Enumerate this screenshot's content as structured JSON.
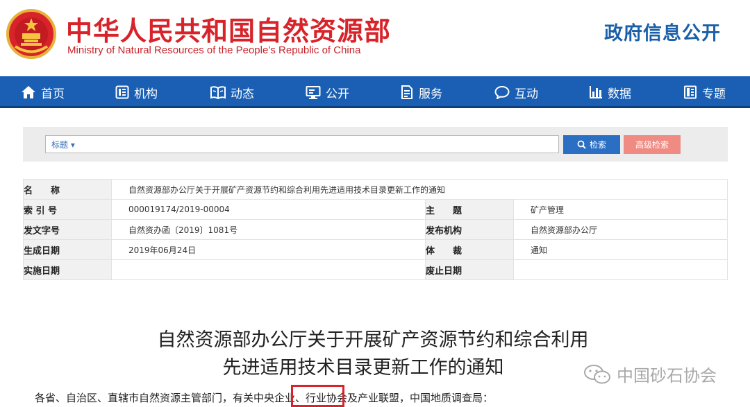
{
  "header": {
    "title_cn": "中华人民共和国自然资源部",
    "title_en": "Ministry of Natural Resources of the People’s Republic of China",
    "gov_open": "政府信息公开",
    "brand_color": "#d8232a"
  },
  "nav": {
    "items": [
      {
        "label": "首页",
        "icon": "home-icon"
      },
      {
        "label": "机构",
        "icon": "org-icon"
      },
      {
        "label": "动态",
        "icon": "book-icon"
      },
      {
        "label": "公开",
        "icon": "monitor-icon"
      },
      {
        "label": "服务",
        "icon": "document-icon"
      },
      {
        "label": "互动",
        "icon": "chat-icon"
      },
      {
        "label": "数据",
        "icon": "bar-chart-icon"
      },
      {
        "label": "专题",
        "icon": "folder-icon"
      }
    ],
    "color": "#1a5fb3"
  },
  "search": {
    "field_select": "标题",
    "field_select_arrow": "▾",
    "value": "",
    "search_label": "检索",
    "advanced_label": "高级检索"
  },
  "info": {
    "name_label": "名　　称",
    "name_value": "自然资源部办公厅关于开展矿产资源节约和综合利用先进适用技术目录更新工作的通知",
    "index_label": "索 引 号",
    "index_value": "000019174/2019-00004",
    "subject_label": "主　　题",
    "subject_value": "矿产管理",
    "docno_label": "发文字号",
    "docno_value": "自然资办函〔2019〕1081号",
    "issuer_label": "发布机构",
    "issuer_value": "自然资源部办公厅",
    "created_label": "生成日期",
    "created_value": "2019年06月24日",
    "genre_label": "体　　裁",
    "genre_value": "通知",
    "effective_label": "实施日期",
    "effective_value": "",
    "expired_label": "废止日期",
    "expired_value": ""
  },
  "document": {
    "title_line1": "自然资源部办公厅关于开展矿产资源节约和综合利用",
    "title_line2": "先进适用技术目录更新工作的通知",
    "body_line1": "各省、自治区、直辖市自然资源主管部门，有关中央企业、行业协会及产业联盟，中国地质调查局："
  },
  "watermark": {
    "text": "中国砂石协会"
  }
}
